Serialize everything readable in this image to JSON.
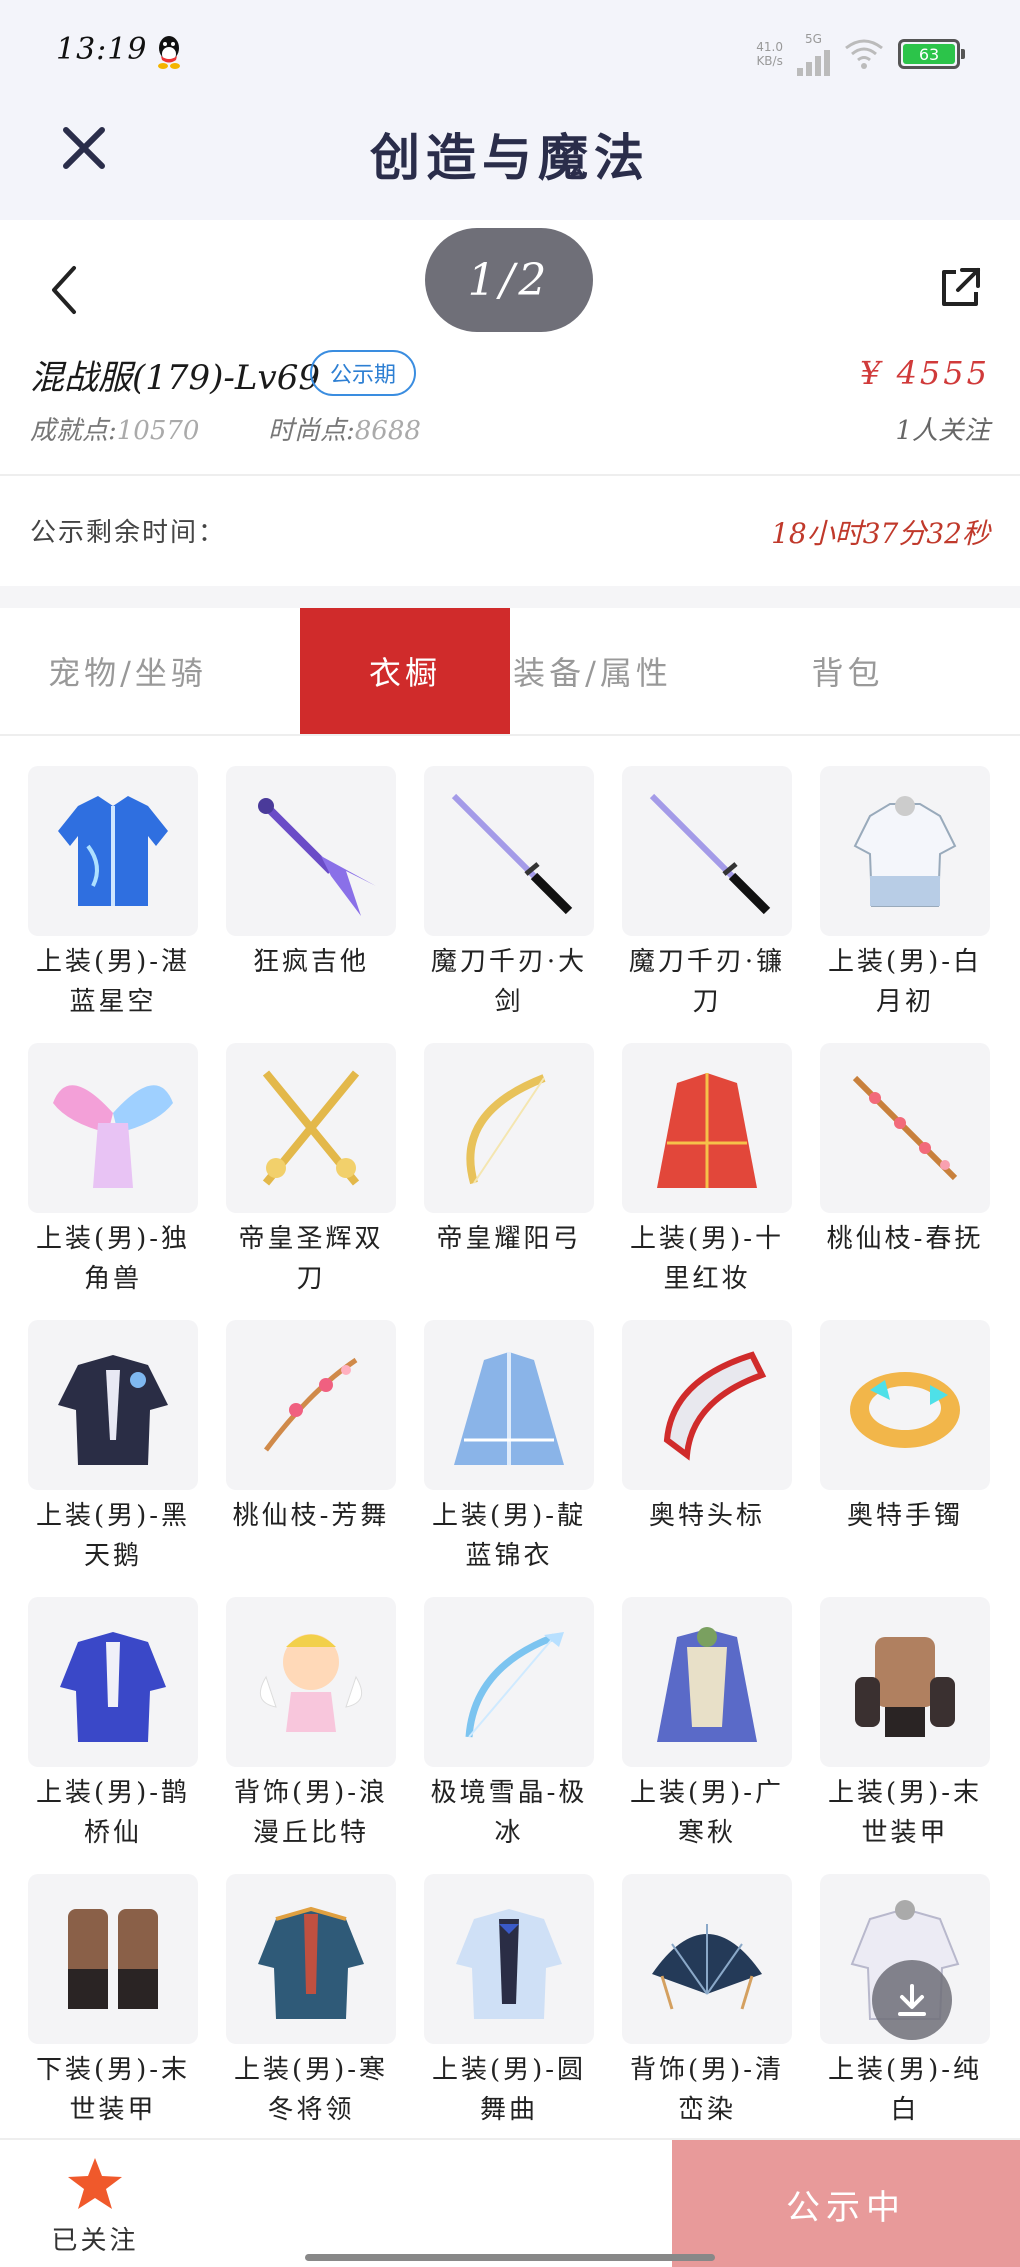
{
  "status_bar": {
    "time": "13:19",
    "net_speed_top": "41.0",
    "net_speed_bottom": "KB/s",
    "network": "5G",
    "battery": "63"
  },
  "title_bar": {
    "title": "创造与魔法"
  },
  "nav": {
    "page_indicator": "1/2"
  },
  "item": {
    "name": "混战服(179)-Lv69",
    "badge": "公示期",
    "price": "¥ 4555",
    "achievement_label": "成就点:",
    "achievement_value": "10570",
    "fashion_label": "时尚点:",
    "fashion_value": "8688",
    "watchers": "1人关注",
    "remaining_label": "公示剩余时间：",
    "remaining_value": "18小时37分32秒"
  },
  "tabs": [
    {
      "label": "宠物/坐骑"
    },
    {
      "label": "衣橱"
    },
    {
      "label": "装备/属性"
    },
    {
      "label": "背包"
    }
  ],
  "wardrobe_items": [
    {
      "label": "上装(男)-湛蓝星空",
      "icon": "blue-coat-icon"
    },
    {
      "label": "狂疯吉他",
      "icon": "guitar-icon"
    },
    {
      "label": "魔刀千刃·大剑",
      "icon": "katana-icon"
    },
    {
      "label": "魔刀千刃·镰刀",
      "icon": "katana-icon"
    },
    {
      "label": "上装(男)-白月初",
      "icon": "white-shirt-icon"
    },
    {
      "label": "上装(男)-独角兽",
      "icon": "unicorn-wings-icon"
    },
    {
      "label": "帝皇圣辉双刀",
      "icon": "golden-twin-blades-icon"
    },
    {
      "label": "帝皇耀阳弓",
      "icon": "golden-bow-icon"
    },
    {
      "label": "上装(男)-十里红妆",
      "icon": "red-robe-icon"
    },
    {
      "label": "桃仙枝-春抚",
      "icon": "peach-branch-icon"
    },
    {
      "label": "上装(男)-黑天鹅",
      "icon": "black-coat-icon"
    },
    {
      "label": "桃仙枝-芳舞",
      "icon": "peach-blossom-icon"
    },
    {
      "label": "上装(男)-靛蓝锦衣",
      "icon": "indigo-robe-icon"
    },
    {
      "label": "奥特头标",
      "icon": "ultra-crest-icon"
    },
    {
      "label": "奥特手镯",
      "icon": "ultra-bracelet-icon"
    },
    {
      "label": "上装(男)-鹊桥仙",
      "icon": "blue-suit-icon"
    },
    {
      "label": "背饰(男)-浪漫丘比特",
      "icon": "cupid-icon"
    },
    {
      "label": "极境雪晶-极冰",
      "icon": "ice-bow-icon"
    },
    {
      "label": "上装(男)-广寒秋",
      "icon": "autumn-robe-icon"
    },
    {
      "label": "上装(男)-末世装甲",
      "icon": "armor-top-icon"
    },
    {
      "label": "下装(男)-末世装甲",
      "icon": "armor-boots-icon"
    },
    {
      "label": "上装(男)-寒冬将领",
      "icon": "winter-general-icon"
    },
    {
      "label": "上装(男)-圆舞曲",
      "icon": "waltz-coat-icon"
    },
    {
      "label": "背饰(男)-清峦染",
      "icon": "fan-icon"
    },
    {
      "label": "上装(男)-纯白",
      "icon": "white-coat-icon"
    }
  ],
  "bottom": {
    "follow_label": "已关注",
    "status_label": "公示中"
  },
  "colors": {
    "accent_red": "#d02b2b",
    "price_red": "#d03a3a",
    "badge_blue": "#2d7fd3",
    "status_button": "#e89a9a",
    "star_orange": "#f0592b"
  }
}
